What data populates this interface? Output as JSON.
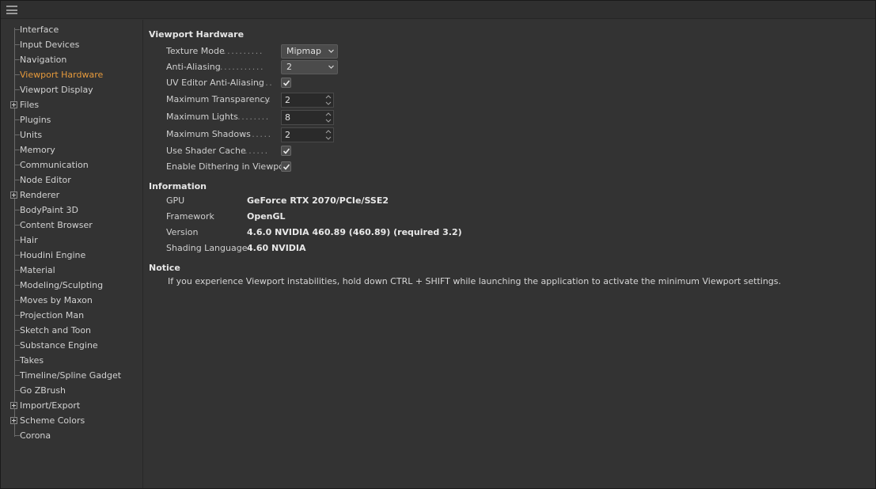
{
  "sidebar": {
    "items": [
      {
        "label": "Interface"
      },
      {
        "label": "Input Devices"
      },
      {
        "label": "Navigation"
      },
      {
        "label": "Viewport Hardware"
      },
      {
        "label": "Viewport Display"
      },
      {
        "label": "Files"
      },
      {
        "label": "Plugins"
      },
      {
        "label": "Units"
      },
      {
        "label": "Memory"
      },
      {
        "label": "Communication"
      },
      {
        "label": "Node Editor"
      },
      {
        "label": "Renderer"
      },
      {
        "label": "BodyPaint 3D"
      },
      {
        "label": "Content Browser"
      },
      {
        "label": "Hair"
      },
      {
        "label": "Houdini Engine"
      },
      {
        "label": "Material"
      },
      {
        "label": "Modeling/Sculpting"
      },
      {
        "label": "Moves by Maxon"
      },
      {
        "label": "Projection Man"
      },
      {
        "label": "Sketch and Toon"
      },
      {
        "label": "Substance Engine"
      },
      {
        "label": "Takes"
      },
      {
        "label": "Timeline/Spline Gadget"
      },
      {
        "label": "Go ZBrush"
      },
      {
        "label": "Import/Export"
      },
      {
        "label": "Scheme Colors"
      },
      {
        "label": "Corona"
      }
    ],
    "active_color": "#e69a3c"
  },
  "viewport_hardware": {
    "title": "Viewport Hardware",
    "texture_mode": {
      "label": "Texture Mode",
      "value": "Mipmap"
    },
    "anti_aliasing": {
      "label": "Anti-Aliasing",
      "value": "2"
    },
    "uv_editor_aa": {
      "label": "UV Editor Anti-Aliasing",
      "checked": true
    },
    "max_transparency": {
      "label": "Maximum Transparency",
      "value": "2"
    },
    "max_lights": {
      "label": "Maximum Lights",
      "value": "8"
    },
    "max_shadows": {
      "label": "Maximum Shadows",
      "value": "2"
    },
    "use_shader_cache": {
      "label": "Use Shader Cache",
      "checked": true
    },
    "enable_dithering": {
      "label": "Enable Dithering in Viewport",
      "checked": true
    }
  },
  "information": {
    "title": "Information",
    "rows": [
      {
        "key": "GPU",
        "value": "GeForce RTX 2070/PCIe/SSE2"
      },
      {
        "key": "Framework",
        "value": "OpenGL"
      },
      {
        "key": "Version",
        "value": "4.6.0 NVIDIA 460.89 (460.89) (required 3.2)"
      },
      {
        "key": "Shading Language",
        "value": "4.60 NVIDIA"
      }
    ]
  },
  "notice": {
    "title": "Notice",
    "text": "If you experience Viewport instabilities, hold down CTRL + SHIFT while launching the application to activate the minimum Viewport settings."
  }
}
